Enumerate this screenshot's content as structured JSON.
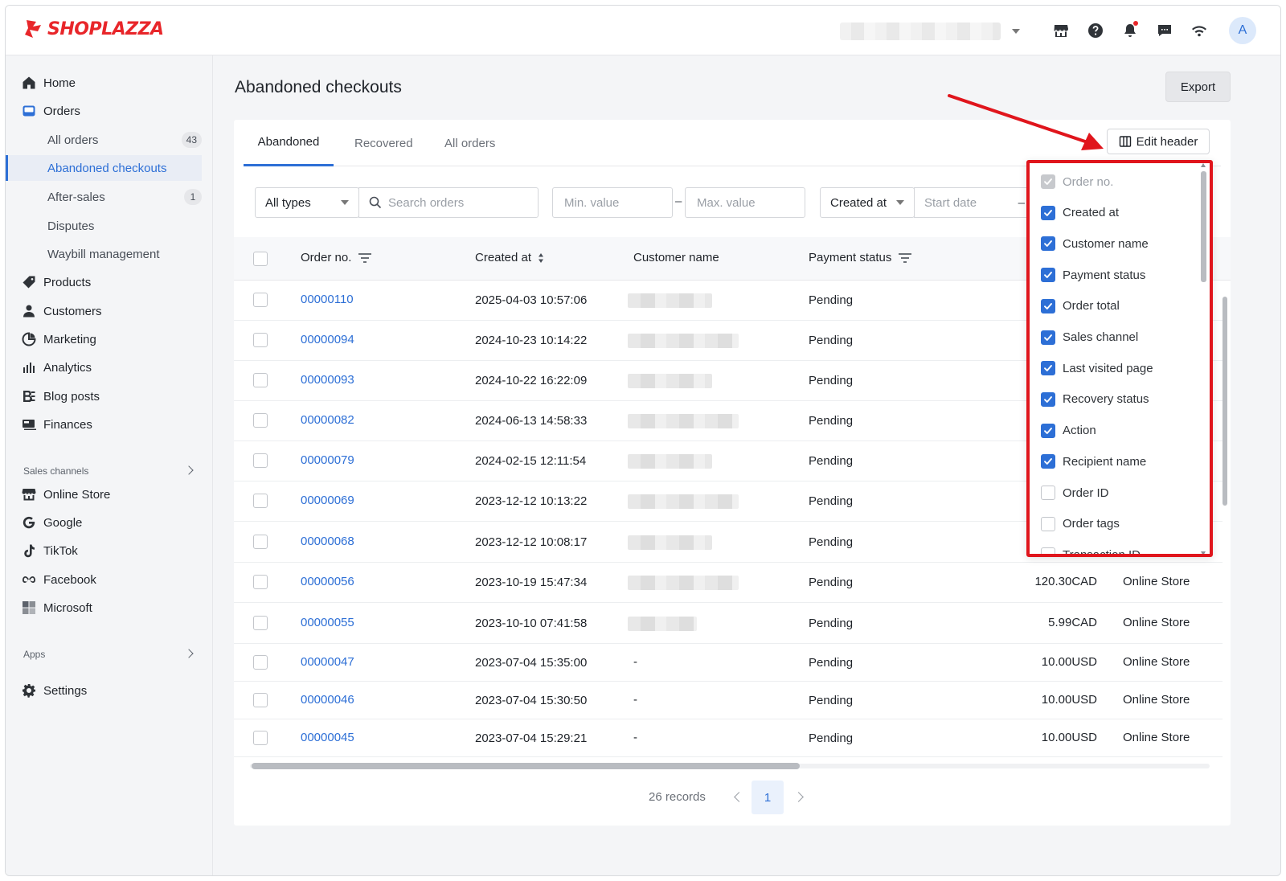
{
  "brand": {
    "name": "SHOPLAZZA",
    "color": "#e8262a"
  },
  "header": {
    "avatar_initial": "A",
    "icons": [
      "store-icon",
      "help-icon",
      "bell-icon",
      "chat-icon",
      "wifi-icon"
    ]
  },
  "sidebar": {
    "items": [
      {
        "label": "Home",
        "icon": "home-icon"
      },
      {
        "label": "Orders",
        "icon": "orders-icon"
      },
      {
        "label": "Products",
        "icon": "tag-icon"
      },
      {
        "label": "Customers",
        "icon": "person-icon"
      },
      {
        "label": "Marketing",
        "icon": "marketing-icon"
      },
      {
        "label": "Analytics",
        "icon": "bar-chart-icon"
      },
      {
        "label": "Blog posts",
        "icon": "blog-icon"
      },
      {
        "label": "Finances",
        "icon": "finance-icon"
      }
    ],
    "orders_sub": [
      {
        "label": "All orders",
        "badge": "43"
      },
      {
        "label": "Abandoned checkouts",
        "badge": ""
      },
      {
        "label": "After-sales",
        "badge": "1"
      },
      {
        "label": "Disputes",
        "badge": ""
      },
      {
        "label": "Waybill management",
        "badge": ""
      }
    ],
    "sales_channels_label": "Sales channels",
    "channels": [
      {
        "label": "Online Store",
        "icon": "store-icon"
      },
      {
        "label": "Google",
        "icon": "google-icon"
      },
      {
        "label": "TikTok",
        "icon": "tiktok-icon"
      },
      {
        "label": "Facebook",
        "icon": "meta-icon"
      },
      {
        "label": "Microsoft",
        "icon": "microsoft-icon"
      }
    ],
    "apps_label": "Apps",
    "settings_label": "Settings"
  },
  "page": {
    "title": "Abandoned checkouts",
    "export_label": "Export",
    "tabs": [
      "Abandoned",
      "Recovered",
      "All orders"
    ],
    "edit_header_label": "Edit header"
  },
  "filters": {
    "type_value": "All types",
    "search_placeholder": "Search orders",
    "min_placeholder": "Min. value",
    "max_placeholder": "Max. value",
    "dash": "–",
    "date_field_value": "Created at",
    "start_date_placeholder": "Start date"
  },
  "table": {
    "headers": {
      "order_no": "Order no.",
      "created_at": "Created at",
      "customer_name": "Customer name",
      "payment_status": "Payment status"
    },
    "rows": [
      {
        "order": "00000110",
        "created": "2025-04-03 10:57:06",
        "customer": "",
        "payment": "Pending",
        "total": "",
        "channel": ""
      },
      {
        "order": "00000094",
        "created": "2024-10-23 10:14:22",
        "customer": "",
        "payment": "Pending",
        "total": "",
        "channel": ""
      },
      {
        "order": "00000093",
        "created": "2024-10-22 16:22:09",
        "customer": "",
        "payment": "Pending",
        "total": "",
        "channel": ""
      },
      {
        "order": "00000082",
        "created": "2024-06-13 14:58:33",
        "customer": "",
        "payment": "Pending",
        "total": "",
        "channel": ""
      },
      {
        "order": "00000079",
        "created": "2024-02-15 12:11:54",
        "customer": "",
        "payment": "Pending",
        "total": "",
        "channel": ""
      },
      {
        "order": "00000069",
        "created": "2023-12-12 10:13:22",
        "customer": "",
        "payment": "Pending",
        "total": "",
        "channel": ""
      },
      {
        "order": "00000068",
        "created": "2023-12-12 10:08:17",
        "customer": "",
        "payment": "Pending",
        "total": "",
        "channel": ""
      },
      {
        "order": "00000056",
        "created": "2023-10-19 15:47:34",
        "customer": "",
        "payment": "Pending",
        "total": "120.30CAD",
        "channel": "Online Store"
      },
      {
        "order": "00000055",
        "created": "2023-10-10 07:41:58",
        "customer": "",
        "payment": "Pending",
        "total": "5.99CAD",
        "channel": "Online Store"
      },
      {
        "order": "00000047",
        "created": "2023-07-04 15:35:00",
        "customer": "-",
        "payment": "Pending",
        "total": "10.00USD",
        "channel": "Online Store"
      },
      {
        "order": "00000046",
        "created": "2023-07-04 15:30:50",
        "customer": "-",
        "payment": "Pending",
        "total": "10.00USD",
        "channel": "Online Store"
      },
      {
        "order": "00000045",
        "created": "2023-07-04 15:29:21",
        "customer": "-",
        "payment": "Pending",
        "total": "10.00USD",
        "channel": "Online Store"
      }
    ]
  },
  "pagination": {
    "records": "26 records",
    "current_page": "1"
  },
  "edit_header_panel": {
    "options": [
      {
        "label": "Order no.",
        "checked": true,
        "disabled": true
      },
      {
        "label": "Created at",
        "checked": true,
        "disabled": false
      },
      {
        "label": "Customer name",
        "checked": true,
        "disabled": false
      },
      {
        "label": "Payment status",
        "checked": true,
        "disabled": false
      },
      {
        "label": "Order total",
        "checked": true,
        "disabled": false
      },
      {
        "label": "Sales channel",
        "checked": true,
        "disabled": false
      },
      {
        "label": "Last visited page",
        "checked": true,
        "disabled": false
      },
      {
        "label": "Recovery status",
        "checked": true,
        "disabled": false
      },
      {
        "label": "Action",
        "checked": true,
        "disabled": false
      },
      {
        "label": "Recipient name",
        "checked": true,
        "disabled": false
      },
      {
        "label": "Order ID",
        "checked": false,
        "disabled": false
      },
      {
        "label": "Order tags",
        "checked": false,
        "disabled": false
      },
      {
        "label": "Transaction ID",
        "checked": false,
        "disabled": false
      }
    ]
  },
  "colors": {
    "accent": "#2d6fd6",
    "annotation": "#e0151c"
  }
}
